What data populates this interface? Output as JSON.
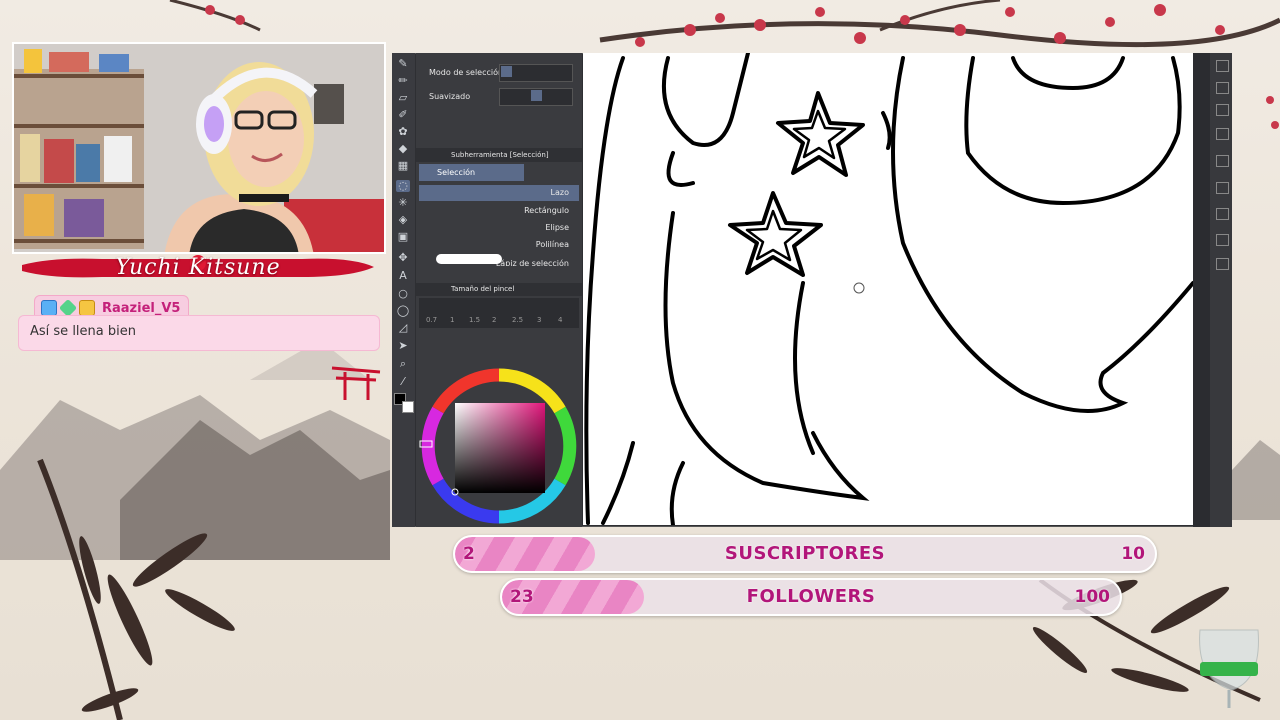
{
  "streamer": {
    "name": "Yuchi Kitsune"
  },
  "chat": {
    "username": "Raaziel_V5",
    "message": "Así se llena bien",
    "badges": [
      "verified-badge-icon",
      "gem-badge-icon",
      "crown-badge-icon"
    ]
  },
  "app": {
    "tool_property": {
      "selection_mode_label": "Modo de selección",
      "smoothing_label": "Suavizado"
    },
    "subtool_panel": {
      "header": "Subherramienta [Selección]",
      "tab": "Selección",
      "items": [
        "Lazo",
        "Rectángulo",
        "Elipse",
        "Polilínea",
        "Lápiz de selección"
      ],
      "active_item": "Lazo"
    },
    "brush_size": {
      "header": "Tamaño del pincel",
      "sizes": [
        "0.7",
        "1",
        "1.5",
        "2",
        "2.5",
        "3",
        "4"
      ]
    }
  },
  "goals": {
    "subscribers": {
      "label": "SUSCRIPTORES",
      "current": "2",
      "target": "10",
      "progress": 0.2
    },
    "followers": {
      "label": "FOLLOWERS",
      "current": "23",
      "target": "100",
      "progress": 0.23
    }
  },
  "colors": {
    "accent": "#b2167a",
    "banner": "#c8102e",
    "bar_fill": "#e985c4"
  }
}
